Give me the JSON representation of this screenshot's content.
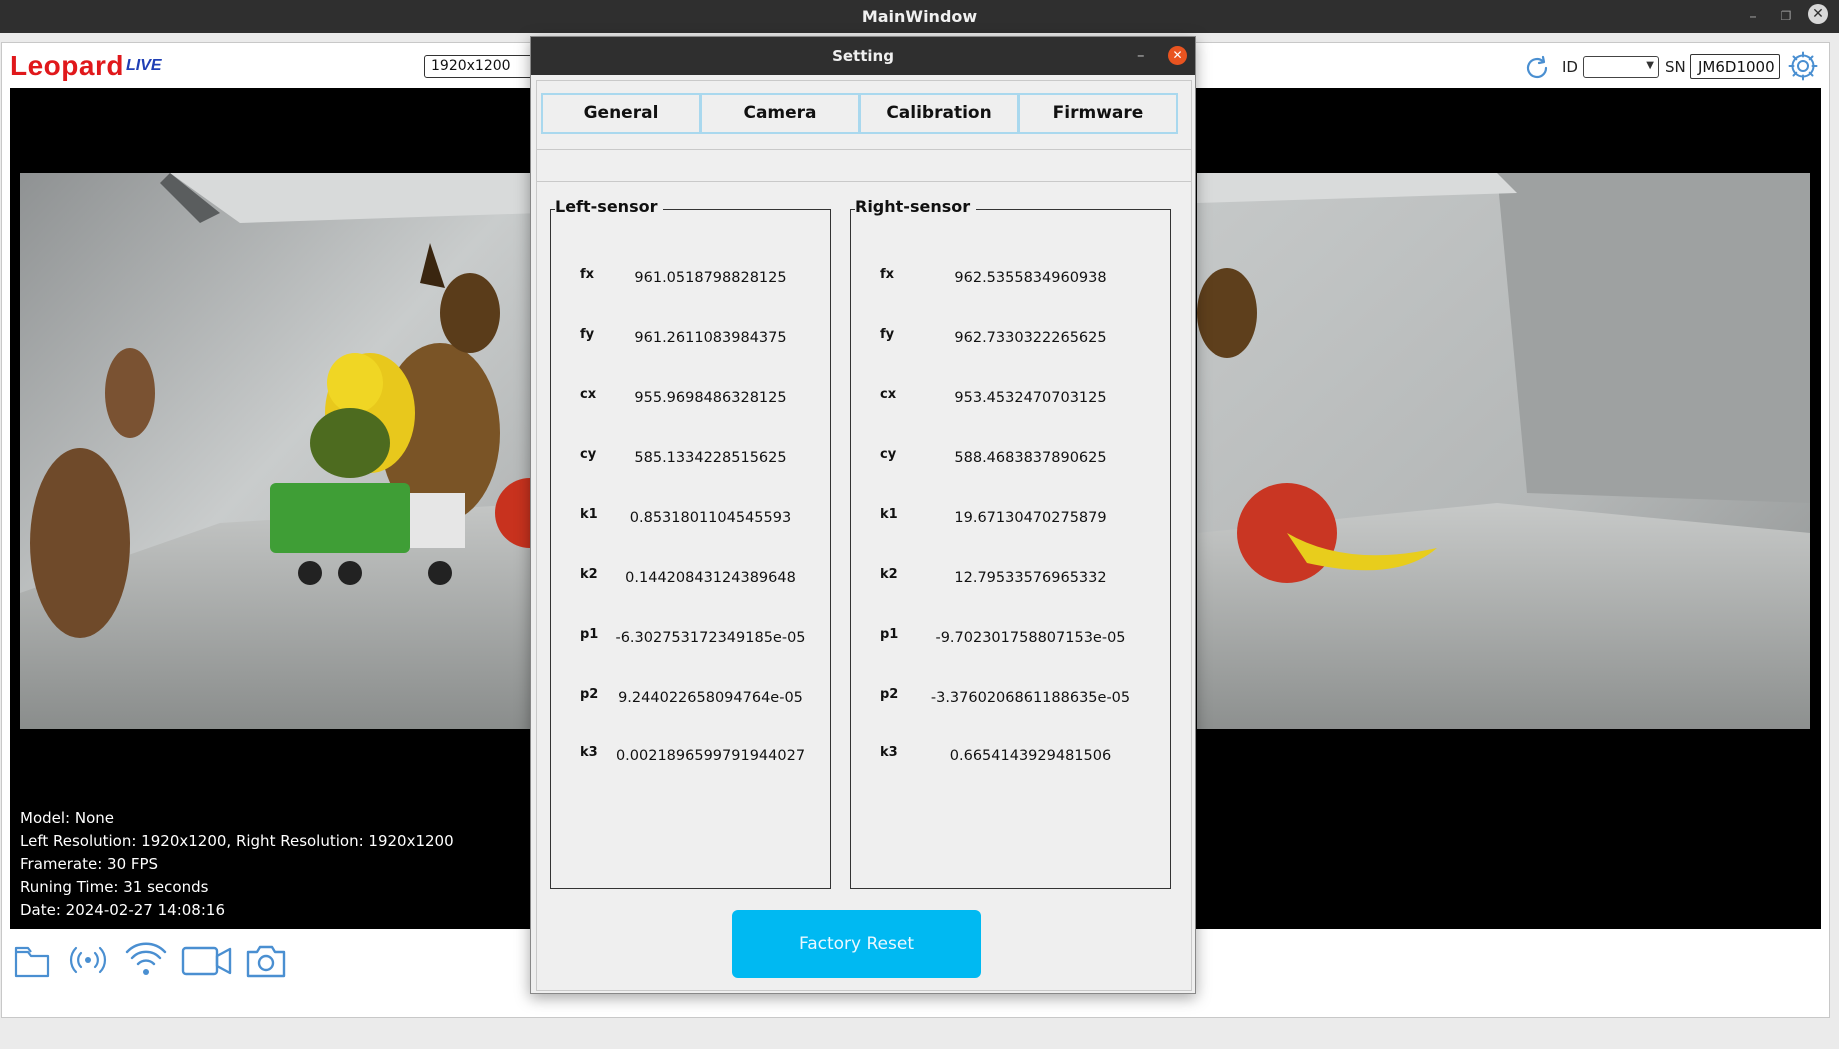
{
  "window": {
    "title": "MainWindow"
  },
  "header": {
    "brand": "Leopard",
    "live": "LIVE",
    "resolution": "1920x1200",
    "id_label": "ID",
    "sn_label": "SN",
    "sn_value": "JM6D1000"
  },
  "info": {
    "model": "Model: None",
    "resolution": "Left Resolution: 1920x1200, Right Resolution: 1920x1200",
    "framerate": "Framerate: 30 FPS",
    "runtime": "Runing Time: 31 seconds",
    "date": "Date: 2024-02-27 14:08:16"
  },
  "toolbar": {
    "icons": [
      "folder-icon",
      "broadcast-icon",
      "wifi-icon",
      "video-camera-icon",
      "camera-icon"
    ]
  },
  "dialog": {
    "title": "Setting",
    "tabs": [
      "General",
      "Camera",
      "Calibration",
      "Firmware"
    ],
    "active_tab": "Calibration",
    "left": {
      "title": "Left-sensor",
      "params": [
        {
          "key": "fx",
          "value": "961.0518798828125"
        },
        {
          "key": "fy",
          "value": "961.2611083984375"
        },
        {
          "key": "cx",
          "value": "955.9698486328125"
        },
        {
          "key": "cy",
          "value": "585.1334228515625"
        },
        {
          "key": "k1",
          "value": "0.8531801104545593"
        },
        {
          "key": "k2",
          "value": "0.14420843124389648"
        },
        {
          "key": "p1",
          "value": "-6.302753172349185e-05"
        },
        {
          "key": "p2",
          "value": "9.244022658094764e-05"
        },
        {
          "key": "k3",
          "value": "0.0021896599791944027"
        }
      ]
    },
    "right": {
      "title": "Right-sensor",
      "params": [
        {
          "key": "fx",
          "value": "962.5355834960938"
        },
        {
          "key": "fy",
          "value": "962.7330322265625"
        },
        {
          "key": "cx",
          "value": "953.4532470703125"
        },
        {
          "key": "cy",
          "value": "588.4683837890625"
        },
        {
          "key": "k1",
          "value": "19.67130470275879"
        },
        {
          "key": "k2",
          "value": "12.79533576965332"
        },
        {
          "key": "p1",
          "value": "-9.702301758807153e-05"
        },
        {
          "key": "p2",
          "value": "-3.3760206861188635e-05"
        },
        {
          "key": "k3",
          "value": "0.6654143929481506"
        }
      ]
    },
    "factory_reset": "Factory Reset"
  },
  "colors": {
    "brand": "#e0181b",
    "live": "#1f3fb5",
    "accent": "#00b9f2",
    "close": "#e95420",
    "icon_blue": "#4a8fd1"
  }
}
